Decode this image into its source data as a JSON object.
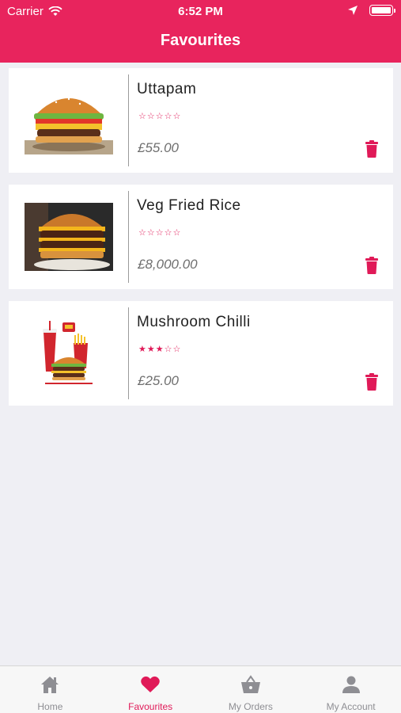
{
  "status_bar": {
    "carrier": "Carrier",
    "time": "6:52 PM"
  },
  "header": {
    "title": "Favourites"
  },
  "favourites": [
    {
      "name": "Uttapam",
      "stars": "☆☆☆☆☆",
      "price": "£55.00",
      "image": "burger-image"
    },
    {
      "name": "Veg Fried Rice",
      "stars": "☆☆☆☆☆",
      "price": "£8,000.00",
      "image": "double-burger-image"
    },
    {
      "name": "Mushroom Chilli",
      "stars": "★★★☆☆",
      "price": "£25.00",
      "rating": 3,
      "image": "combo-meal-image"
    }
  ],
  "tabbar": {
    "home": "Home",
    "favourites": "Favourites",
    "orders": "My Orders",
    "account": "My Account"
  },
  "colors": {
    "accent": "#e8245d",
    "delete": "#e01a58",
    "background": "#efeff4"
  }
}
